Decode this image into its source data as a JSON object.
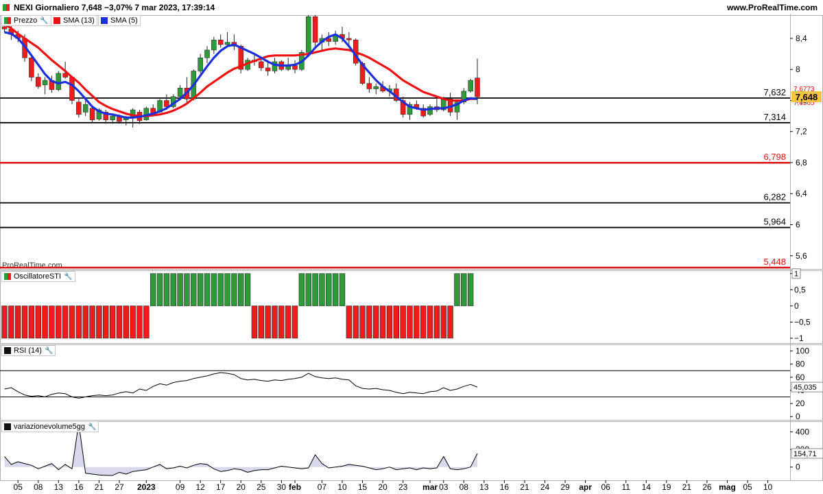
{
  "header": {
    "instrument": "NEXI Giornaliero 7,648 −3,07% 7 mar 2023, 17:39:14",
    "source_url": "www.ProRealTime.com",
    "watermark": "ProRealTime.com"
  },
  "legend": {
    "price": "Prezzo",
    "sma13": "SMA (13)",
    "sma5": "SMA (5)",
    "sti": "OscillatoreSTI",
    "rsi": "RSI (14)",
    "vol": "variazionevolume5gg"
  },
  "colors": {
    "up": "#2e9a3a",
    "down": "#ee1c1c",
    "sma13": "#ee1111",
    "sma5": "#1b2fdb",
    "level_red": "#dd1111",
    "level_black": "#000000",
    "price_tag_bg": "#f5c542",
    "volume_fill": "#d9d9ee"
  },
  "chart_data": [
    {
      "type": "candlestick",
      "title": "NEXI Giornaliero",
      "x_ticks": [
        {
          "label": "05",
          "i": 2
        },
        {
          "label": "08",
          "i": 5
        },
        {
          "label": "13",
          "i": 8
        },
        {
          "label": "16",
          "i": 11
        },
        {
          "label": "21",
          "i": 14
        },
        {
          "label": "27",
          "i": 17
        },
        {
          "label": "2023",
          "i": 21,
          "bold": true
        },
        {
          "label": "09",
          "i": 26
        },
        {
          "label": "12",
          "i": 29
        },
        {
          "label": "17",
          "i": 32
        },
        {
          "label": "20",
          "i": 35
        },
        {
          "label": "25",
          "i": 38
        },
        {
          "label": "30",
          "i": 41
        },
        {
          "label": "feb",
          "i": 43,
          "bold": true
        },
        {
          "label": "07",
          "i": 47
        },
        {
          "label": "10",
          "i": 50
        },
        {
          "label": "15",
          "i": 53
        },
        {
          "label": "20",
          "i": 56
        },
        {
          "label": "23",
          "i": 59
        },
        {
          "label": "mar",
          "i": 63,
          "bold": true
        },
        {
          "label": "03",
          "i": 65
        },
        {
          "label": "08",
          "i": 68
        },
        {
          "label": "13",
          "i": 71
        },
        {
          "label": "16",
          "i": 74
        },
        {
          "label": "21",
          "i": 77
        },
        {
          "label": "24",
          "i": 80
        },
        {
          "label": "29",
          "i": 83
        },
        {
          "label": "apr",
          "i": 86,
          "bold": true
        },
        {
          "label": "06",
          "i": 89
        },
        {
          "label": "11",
          "i": 92
        },
        {
          "label": "14",
          "i": 95
        },
        {
          "label": "19",
          "i": 98
        },
        {
          "label": "21",
          "i": 101
        },
        {
          "label": "26",
          "i": 104
        },
        {
          "label": "mag",
          "i": 107,
          "bold": true
        },
        {
          "label": "05",
          "i": 110
        },
        {
          "label": "10",
          "i": 113
        }
      ],
      "y_ticks": [
        8.4,
        8,
        7.6,
        7.2,
        6.8,
        6.4,
        6,
        5.6
      ],
      "y_tick_labels": [
        "8,4",
        "8",
        "7,6",
        "7,2",
        "6,8",
        "6,4",
        "6",
        "5,6"
      ],
      "ylim": [
        5.43,
        8.7
      ],
      "candles": [
        [
          8.55,
          8.62,
          8.48,
          8.52
        ],
        [
          8.52,
          8.58,
          8.38,
          8.45
        ],
        [
          8.45,
          8.5,
          8.35,
          8.4
        ],
        [
          8.4,
          8.45,
          8.1,
          8.15
        ],
        [
          8.15,
          8.2,
          7.85,
          7.9
        ],
        [
          7.9,
          7.95,
          7.75,
          7.78
        ],
        [
          7.8,
          7.9,
          7.68,
          7.86
        ],
        [
          7.86,
          7.92,
          7.7,
          7.74
        ],
        [
          7.74,
          7.98,
          7.72,
          7.95
        ],
        [
          7.95,
          8.1,
          7.88,
          7.9
        ],
        [
          7.9,
          7.92,
          7.55,
          7.6
        ],
        [
          7.58,
          7.62,
          7.38,
          7.42
        ],
        [
          7.45,
          7.6,
          7.4,
          7.55
        ],
        [
          7.5,
          7.52,
          7.32,
          7.35
        ],
        [
          7.36,
          7.5,
          7.34,
          7.48
        ],
        [
          7.45,
          7.48,
          7.3,
          7.35
        ],
        [
          7.35,
          7.42,
          7.3,
          7.4
        ],
        [
          7.4,
          7.42,
          7.3,
          7.33
        ],
        [
          7.35,
          7.4,
          7.28,
          7.38
        ],
        [
          7.38,
          7.5,
          7.25,
          7.48
        ],
        [
          7.45,
          7.48,
          7.3,
          7.34
        ],
        [
          7.35,
          7.52,
          7.34,
          7.5
        ],
        [
          7.5,
          7.55,
          7.4,
          7.44
        ],
        [
          7.45,
          7.62,
          7.44,
          7.6
        ],
        [
          7.6,
          7.68,
          7.48,
          7.52
        ],
        [
          7.52,
          7.68,
          7.5,
          7.65
        ],
        [
          7.65,
          7.8,
          7.6,
          7.76
        ],
        [
          7.76,
          7.9,
          7.55,
          7.62
        ],
        [
          7.62,
          8.0,
          7.6,
          7.98
        ],
        [
          7.98,
          8.2,
          7.95,
          8.15
        ],
        [
          8.15,
          8.3,
          8.08,
          8.25
        ],
        [
          8.25,
          8.42,
          8.2,
          8.38
        ],
        [
          8.38,
          8.45,
          8.28,
          8.32
        ],
        [
          8.32,
          8.48,
          8.3,
          8.35
        ],
        [
          8.35,
          8.45,
          8.25,
          8.3
        ],
        [
          8.3,
          8.32,
          7.95,
          8.0
        ],
        [
          8.0,
          8.15,
          7.98,
          8.12
        ],
        [
          8.12,
          8.2,
          8.05,
          8.1
        ],
        [
          8.1,
          8.15,
          7.98,
          8.02
        ],
        [
          8.02,
          8.12,
          7.92,
          7.98
        ],
        [
          7.98,
          8.15,
          7.95,
          8.1
        ],
        [
          8.1,
          8.12,
          7.98,
          8.0
        ],
        [
          8.0,
          8.15,
          7.98,
          8.05
        ],
        [
          8.05,
          8.12,
          7.95,
          8.0
        ],
        [
          8.0,
          8.25,
          7.98,
          8.22
        ],
        [
          8.22,
          8.7,
          8.2,
          8.68
        ],
        [
          8.68,
          8.7,
          8.3,
          8.35
        ],
        [
          8.35,
          8.45,
          8.25,
          8.4
        ],
        [
          8.4,
          8.48,
          8.3,
          8.36
        ],
        [
          8.36,
          8.5,
          8.32,
          8.45
        ],
        [
          8.45,
          8.55,
          8.35,
          8.4
        ],
        [
          8.4,
          8.48,
          8.32,
          8.38
        ],
        [
          8.38,
          8.4,
          8.05,
          8.08
        ],
        [
          8.08,
          8.1,
          7.8,
          7.82
        ],
        [
          7.82,
          7.9,
          7.7,
          7.75
        ],
        [
          7.75,
          7.82,
          7.68,
          7.78
        ],
        [
          7.78,
          7.85,
          7.7,
          7.72
        ],
        [
          7.72,
          7.8,
          7.65,
          7.75
        ],
        [
          7.75,
          7.82,
          7.58,
          7.6
        ],
        [
          7.6,
          7.65,
          7.38,
          7.42
        ],
        [
          7.42,
          7.58,
          7.35,
          7.55
        ],
        [
          7.55,
          7.6,
          7.48,
          7.5
        ],
        [
          7.5,
          7.55,
          7.38,
          7.4
        ],
        [
          7.42,
          7.55,
          7.4,
          7.52
        ],
        [
          7.52,
          7.62,
          7.45,
          7.48
        ],
        [
          7.48,
          7.65,
          7.46,
          7.62
        ],
        [
          7.62,
          7.7,
          7.4,
          7.45
        ],
        [
          7.45,
          7.6,
          7.35,
          7.58
        ],
        [
          7.58,
          7.76,
          7.55,
          7.72
        ],
        [
          7.72,
          7.88,
          7.7,
          7.86
        ],
        [
          7.89,
          8.14,
          7.55,
          7.648
        ]
      ],
      "sma13": [
        8.58,
        8.53,
        8.46,
        8.4,
        8.34,
        8.28,
        8.2,
        8.12,
        8.05,
        7.98,
        7.9,
        7.83,
        7.74,
        7.66,
        7.58,
        7.53,
        7.49,
        7.46,
        7.43,
        7.41,
        7.4,
        7.4,
        7.41,
        7.42,
        7.44,
        7.47,
        7.51,
        7.56,
        7.63,
        7.7,
        7.78,
        7.84,
        7.9,
        7.96,
        8.01,
        8.04,
        8.08,
        8.11,
        8.14,
        8.17,
        8.18,
        8.18,
        8.18,
        8.18,
        8.19,
        8.2,
        8.22,
        8.24,
        8.26,
        8.27,
        8.26,
        8.25,
        8.22,
        8.19,
        8.15,
        8.1,
        8.05,
        8.0,
        7.93,
        7.86,
        7.81,
        7.76,
        7.71,
        7.68,
        7.65,
        7.62,
        7.6,
        7.6,
        7.6,
        7.62,
        7.62
      ],
      "sma5": [
        8.48,
        8.46,
        8.4,
        8.3,
        8.18,
        8.06,
        7.94,
        7.85,
        7.82,
        7.84,
        7.8,
        7.72,
        7.62,
        7.52,
        7.46,
        7.43,
        7.42,
        7.4,
        7.38,
        7.38,
        7.39,
        7.41,
        7.43,
        7.46,
        7.5,
        7.56,
        7.62,
        7.7,
        7.8,
        7.92,
        8.04,
        8.15,
        8.24,
        8.3,
        8.32,
        8.28,
        8.24,
        8.2,
        8.15,
        8.1,
        8.06,
        8.05,
        8.05,
        8.06,
        8.1,
        8.18,
        8.28,
        8.36,
        8.42,
        8.45,
        8.4,
        8.3,
        8.18,
        8.06,
        7.96,
        7.86,
        7.78,
        7.72,
        7.65,
        7.58,
        7.52,
        7.5,
        7.48,
        7.49,
        7.5,
        7.5,
        7.52,
        7.55,
        7.6,
        7.63,
        7.62
      ],
      "levels": [
        {
          "value": 7.632,
          "label": "7,632",
          "color": "black"
        },
        {
          "value": 7.314,
          "label": "7,314",
          "color": "black"
        },
        {
          "value": 6.798,
          "label": "6,798",
          "color": "red"
        },
        {
          "value": 6.282,
          "label": "6,282",
          "color": "black"
        },
        {
          "value": 5.964,
          "label": "5,964",
          "color": "black"
        },
        {
          "value": 5.448,
          "label": "5,448",
          "color": "red"
        }
      ],
      "last_price_label": "7,648",
      "small_labels": [
        "7,6773",
        "7,6565"
      ]
    },
    {
      "type": "bar",
      "title": "OscillatoreSTI",
      "ylim": [
        -1.15,
        1.1
      ],
      "y_ticks": [
        1,
        0.5,
        0,
        -0.5,
        -1
      ],
      "y_tick_labels": [
        "1",
        "0,5",
        "0",
        "−0,5",
        "−1"
      ],
      "values": [
        -1,
        -1,
        -1,
        -1,
        -1,
        -1,
        -1,
        -1,
        -1,
        -1,
        -1,
        -1,
        -1,
        -1,
        -1,
        -1,
        -1,
        -1,
        -1,
        -1,
        -1,
        -1,
        1,
        1,
        1,
        1,
        1,
        1,
        1,
        1,
        1,
        1,
        1,
        1,
        1,
        1,
        1,
        -1,
        -1,
        -1,
        -1,
        -1,
        -1,
        -1,
        1,
        1,
        1,
        1,
        1,
        1,
        1,
        -1,
        -1,
        -1,
        -1,
        -1,
        -1,
        -1,
        -1,
        -1,
        -1,
        -1,
        -1,
        -1,
        -1,
        -1,
        -1,
        1,
        1,
        1
      ]
    },
    {
      "type": "line",
      "title": "RSI (14)",
      "ylim": [
        -5,
        110
      ],
      "y_ticks": [
        100,
        80,
        60,
        40,
        20,
        0
      ],
      "y_tick_labels": [
        "100",
        "80",
        "60",
        "40",
        "20",
        "0"
      ],
      "bands": [
        70,
        30
      ],
      "last_label": "45,035",
      "values": [
        42,
        44,
        38,
        33,
        31,
        32,
        30,
        34,
        36,
        35,
        30,
        28,
        30,
        32,
        33,
        32,
        33,
        36,
        38,
        36,
        42,
        40,
        46,
        50,
        48,
        52,
        54,
        55,
        58,
        60,
        62,
        65,
        67,
        66,
        64,
        58,
        56,
        57,
        55,
        54,
        56,
        55,
        57,
        58,
        60,
        66,
        61,
        59,
        58,
        59,
        57,
        56,
        47,
        43,
        42,
        43,
        41,
        40,
        37,
        35,
        37,
        36,
        35,
        38,
        39,
        44,
        40,
        42,
        46,
        49,
        45.035
      ]
    },
    {
      "type": "area",
      "title": "variazionevolume5gg",
      "ylim": [
        -150,
        520
      ],
      "y_ticks": [
        400,
        200,
        0
      ],
      "y_tick_labels": [
        "400",
        "200",
        "0"
      ],
      "last_label": "154,71",
      "values": [
        120,
        30,
        60,
        40,
        20,
        -20,
        10,
        40,
        -30,
        30,
        -20,
        500,
        -70,
        -80,
        -90,
        -95,
        -95,
        -60,
        -80,
        -50,
        -40,
        -30,
        0,
        30,
        -20,
        -10,
        10,
        -10,
        20,
        40,
        30,
        -20,
        -50,
        -40,
        -20,
        -30,
        -60,
        -40,
        -30,
        -30,
        -10,
        10,
        0,
        -10,
        -20,
        -10,
        140,
        40,
        -10,
        0,
        10,
        30,
        20,
        10,
        -10,
        -30,
        -20,
        0,
        -30,
        -20,
        -10,
        -30,
        -10,
        -20,
        -10,
        120,
        -20,
        -30,
        -20,
        0,
        154.71
      ]
    }
  ]
}
